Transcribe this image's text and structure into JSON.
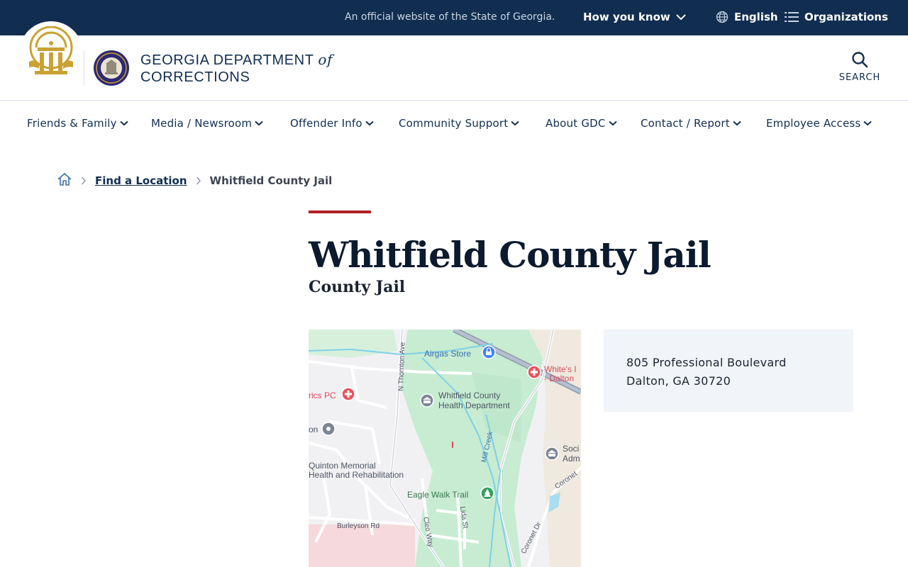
{
  "topbar": {
    "official_text": "An official website of the State of Georgia.",
    "how_you_know": "How you know",
    "language": "English",
    "organizations": "Organizations"
  },
  "header": {
    "org_name_line1": "GEORGIA DEPARTMENT",
    "org_name_of": "of",
    "org_name_line2": "CORRECTIONS",
    "search_label": "SEARCH"
  },
  "nav": {
    "items": [
      {
        "label": "Friends & Family"
      },
      {
        "label": "Media / Newsroom"
      },
      {
        "label": "Offender Info"
      },
      {
        "label": "Community Support"
      },
      {
        "label": "About GDC"
      },
      {
        "label": "Contact / Report"
      },
      {
        "label": "Employee Access"
      }
    ]
  },
  "breadcrumb": {
    "home": "Home",
    "parent": "Find a Location",
    "current": "Whitfield County Jail"
  },
  "page": {
    "title": "Whitfield County Jail",
    "subtitle": "County Jail"
  },
  "address": {
    "line1": "805 Professional Boulevard",
    "line2": "Dalton, GA 30720"
  },
  "map": {
    "labels": {
      "airgas": "Airgas Store",
      "whites_1": "White's I",
      "whites_2": "- Dalton",
      "rics": "rics PC",
      "health_1": "Whitfield County",
      "health_2": "Health Department",
      "on": "on",
      "mill_creek": "Mill Creek",
      "soci_1": "Soci",
      "soci_2": "Adm",
      "quinton_1": "Quinton Memorial",
      "quinton_2": "Health and Rehabilitation",
      "eagle": "Eagle Walk Trail",
      "coronet": "Coronet",
      "coronet_dr": "Coronet Dr",
      "burleyson": "Burleyson Rd",
      "lida": "Lida St",
      "cleo": "Cleo Way",
      "thornton": "N Thornton Ave"
    }
  },
  "colors": {
    "navy": "#112e51",
    "accent_red": "#b21f25",
    "gold": "#c9a233"
  }
}
